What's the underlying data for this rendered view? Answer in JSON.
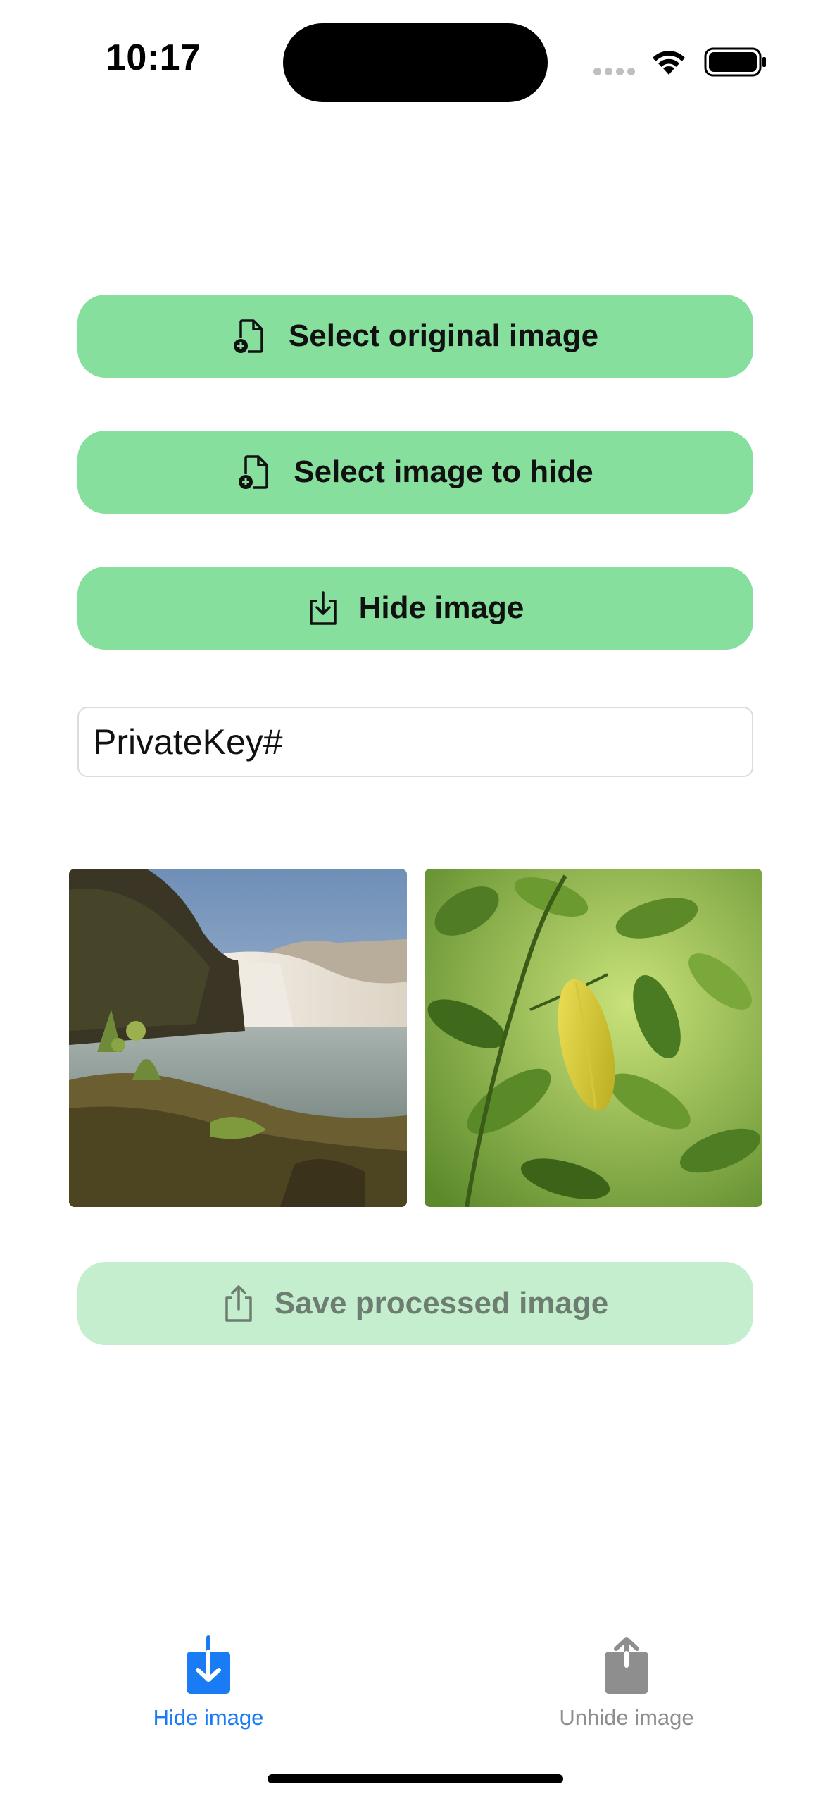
{
  "status_bar": {
    "time": "10:17"
  },
  "buttons": {
    "select_original": "Select original image",
    "select_hide": "Select image to hide",
    "hide_image": "Hide image",
    "save_processed": "Save processed image"
  },
  "key_field": {
    "value": "PrivateKey#"
  },
  "tabs": [
    {
      "label": "Hide image",
      "active": true
    },
    {
      "label": "Unhide image",
      "active": false
    }
  ],
  "colors": {
    "button_green": "#86df9c",
    "button_disabled": "#c4eecd",
    "tab_active": "#1a7cf5",
    "tab_inactive": "#8e8e8e"
  },
  "icons": {
    "select_original": "document-add-icon",
    "select_hide": "document-add-icon",
    "hide": "tray-download-icon",
    "save": "share-icon",
    "tab_hide": "download-square-icon",
    "tab_unhide": "upload-square-icon"
  }
}
